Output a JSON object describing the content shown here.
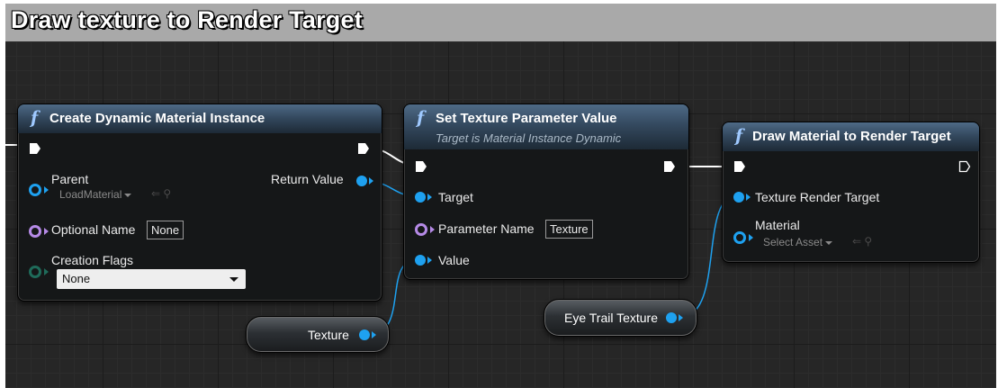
{
  "comment": {
    "title": "Draw texture to Render Target"
  },
  "nodes": {
    "create_dmi": {
      "title": "Create Dynamic Material Instance",
      "pins": {
        "parent": "Parent",
        "return_value": "Return Value",
        "optional_name": "Optional Name",
        "creation_flags": "Creation Flags"
      },
      "parent_asset": "LoadMaterial",
      "optional_name_value": "None",
      "creation_flags_value": "None"
    },
    "set_texture_param": {
      "title": "Set Texture Parameter Value",
      "subtitle": "Target is Material Instance Dynamic",
      "pins": {
        "target": "Target",
        "parameter_name": "Parameter Name",
        "value": "Value"
      },
      "parameter_name_value": "Texture"
    },
    "draw_material": {
      "title": "Draw Material to Render Target",
      "pins": {
        "texture_render_target": "Texture Render Target",
        "material": "Material"
      },
      "material_asset": "Select Asset"
    },
    "var_texture": {
      "label": "Texture"
    },
    "var_eye_trail": {
      "label": "Eye Trail Texture"
    }
  },
  "icons": {
    "function": "function-icon",
    "exec": "exec-pin-icon",
    "browse": "arrow-left-icon",
    "search": "magnifier-icon"
  },
  "colors": {
    "object_pin": "#1ea1f0",
    "name_pin": "#b58ae6",
    "flags_pin": "#1f6b5a",
    "comment_header": "#a9a9a9",
    "graph_background": "#262626"
  }
}
